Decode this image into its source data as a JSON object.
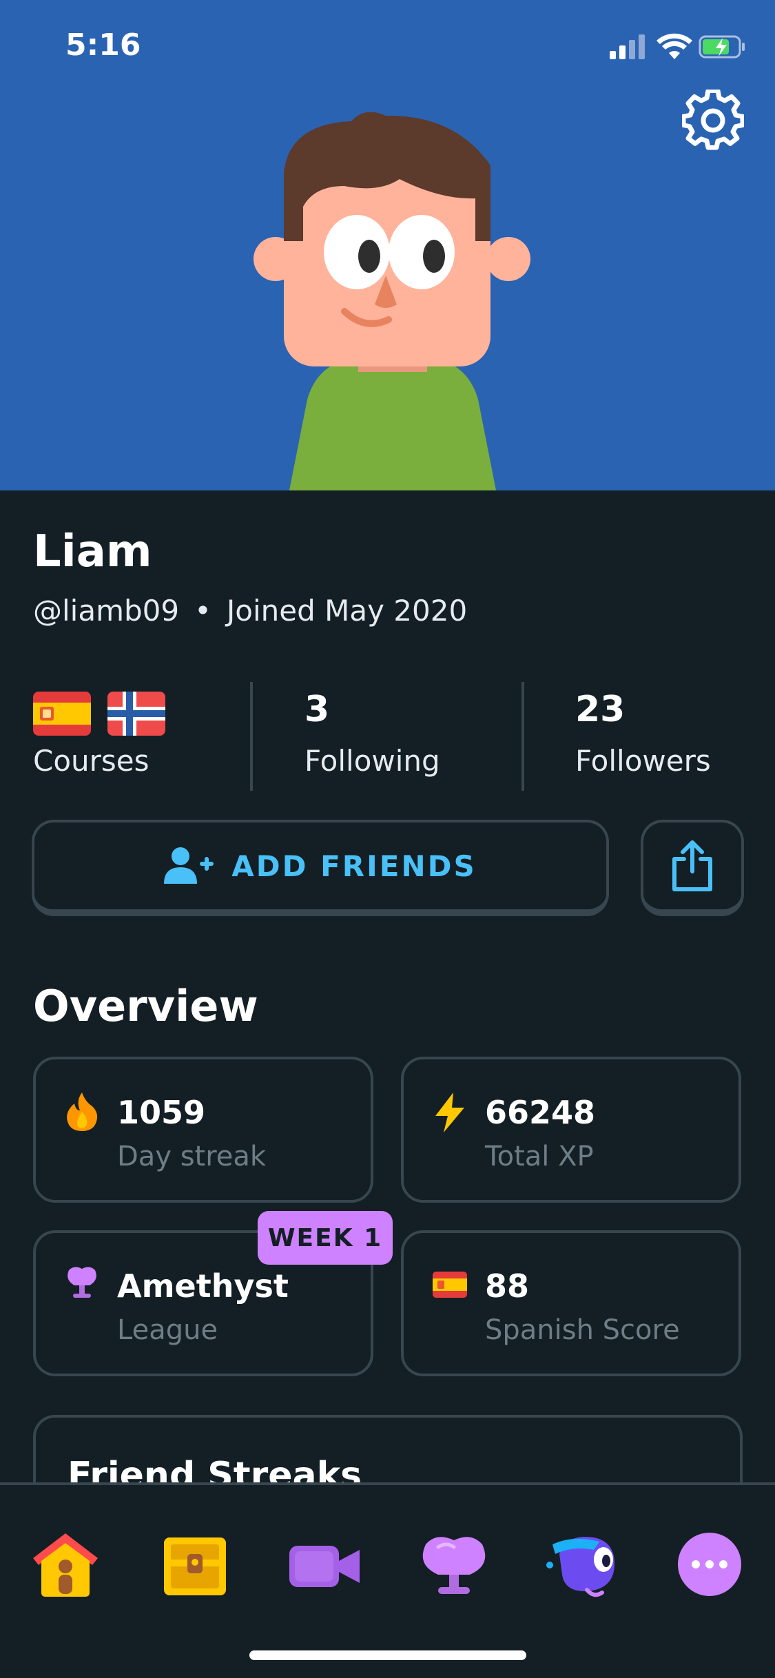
{
  "status_bar": {
    "time": "5:16"
  },
  "profile": {
    "name": "Liam",
    "username": "@liamb09",
    "separator": "•",
    "joined": "Joined May 2020"
  },
  "stats": {
    "courses_label": "Courses",
    "courses_flags": [
      "spain-flag-icon",
      "norway-flag-icon"
    ],
    "following_count": "3",
    "following_label": "Following",
    "followers_count": "23",
    "followers_label": "Followers"
  },
  "actions": {
    "add_friends_label": "ADD FRIENDS",
    "share_icon": "share-icon"
  },
  "overview": {
    "title": "Overview",
    "cards": [
      {
        "icon": "fire-icon",
        "value": "1059",
        "label": "Day streak"
      },
      {
        "icon": "lightning-icon",
        "value": "66248",
        "label": "Total XP"
      },
      {
        "icon": "amethyst-trophy-icon",
        "value": "Amethyst",
        "label": "League",
        "badge": "WEEK 1"
      },
      {
        "icon": "spain-flag-icon",
        "value": "88",
        "label": "Spanish Score"
      }
    ]
  },
  "friend_streaks": {
    "title": "Friend Streaks"
  },
  "tab_bar": {
    "items": [
      "home-icon",
      "treasure-chest-icon",
      "video-call-icon",
      "league-icon",
      "duo-bird-icon",
      "more-icon"
    ]
  },
  "colors": {
    "hero_bg": "#2B63B3",
    "page_bg": "#131F24",
    "border": "#37464F",
    "accent_blue": "#49C0F8",
    "badge_purple": "#CE82FF",
    "muted_text": "#6E7D86"
  }
}
